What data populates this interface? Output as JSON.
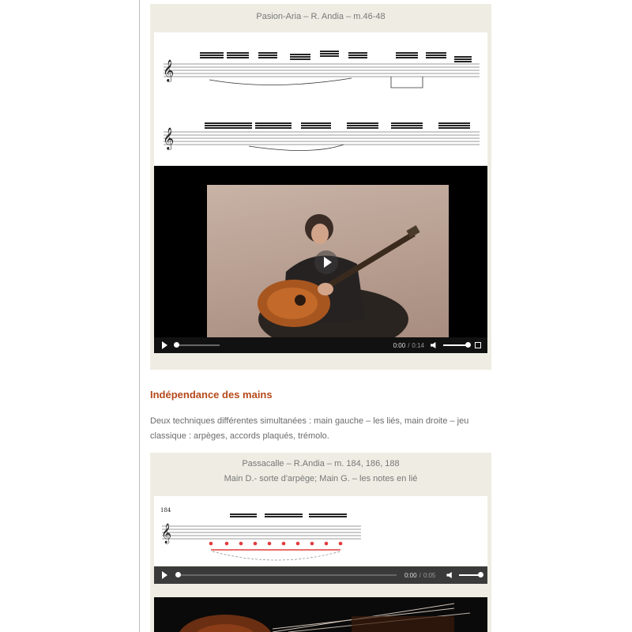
{
  "figure1": {
    "caption": "Pasion-Aria – R. Andia – m.46-48",
    "video": {
      "time_current": "0:00",
      "time_separator": "/",
      "time_total": "0:14"
    }
  },
  "section": {
    "heading": "Indépendance des mains",
    "paragraph": "Deux techniques différentes simultanées : main gauche – les liés, main droite – jeu classique : arpèges, accords plaqués, trémolo."
  },
  "figure2": {
    "caption_line1": "Passacalle – R.Andia – m. 184, 186, 188",
    "caption_line2": "Main D.- sorte d'arpège; Main G. – les notes en lié",
    "score_measure_number": "184",
    "audio": {
      "time_current": "0:00",
      "time_separator": "/",
      "time_total": "0:05"
    }
  },
  "colors": {
    "heading": "#b5491b",
    "figure_bg": "#efede3",
    "score_red": "#e23b3b"
  },
  "icons": [
    "play-icon",
    "volume-icon",
    "fullscreen-icon"
  ]
}
